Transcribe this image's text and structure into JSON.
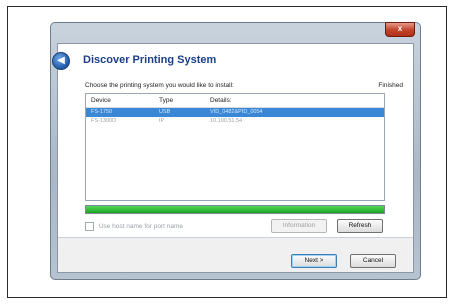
{
  "window": {
    "title": "Discover Printing System",
    "close_glyph": "x"
  },
  "content": {
    "prompt": "Choose the printing system you would like to install:",
    "status": "Finished"
  },
  "list": {
    "columns": [
      "Device",
      "Type",
      "Details:"
    ],
    "rows": [
      {
        "device": "FS-1750",
        "type": "USB",
        "details": "VID_0482&PID_0054"
      },
      {
        "device": "FS-1300D",
        "type": "IP",
        "details": "10.100.51.54"
      }
    ],
    "selected_index": 0
  },
  "progress": {
    "value_percent": 100
  },
  "options": {
    "use_host_name_label": "Use host name for port name"
  },
  "buttons": {
    "information": "Information",
    "refresh": "Refresh",
    "next": "Next >",
    "cancel": "Cancel"
  },
  "colors": {
    "title": "#1a3f86",
    "selection": "#3a87d6",
    "progress": "#17a51f"
  }
}
